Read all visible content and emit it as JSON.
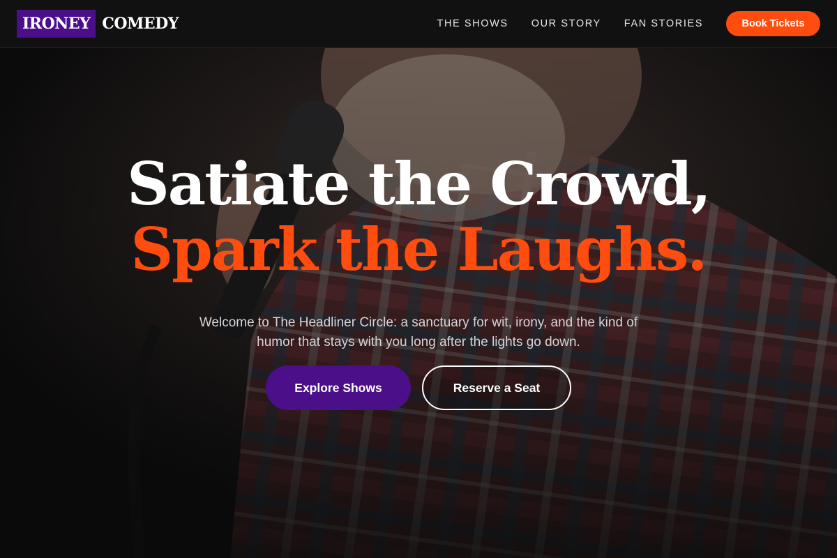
{
  "brand": {
    "logo_box_text": "IRONEY",
    "logo_word": "COMEDY",
    "accent": "#ff4d0f",
    "purple": "#4b0f8a"
  },
  "nav": {
    "links": [
      "THE SHOWS",
      "OUR STORY",
      "FAN STORIES"
    ],
    "cta_label": "Book Tickets"
  },
  "hero": {
    "headline_line1": "Satiate the Crowd,",
    "headline_line2": "Spark the Laughs.",
    "subtitle": "Welcome to The Headliner Circle: a sanctuary for wit, irony, and the kind of humor that stays with you long after the lights go down.",
    "primary_button": "Explore Shows",
    "secondary_button": "Reserve a Seat",
    "background_image": "comedian-with-microphone-photo"
  }
}
